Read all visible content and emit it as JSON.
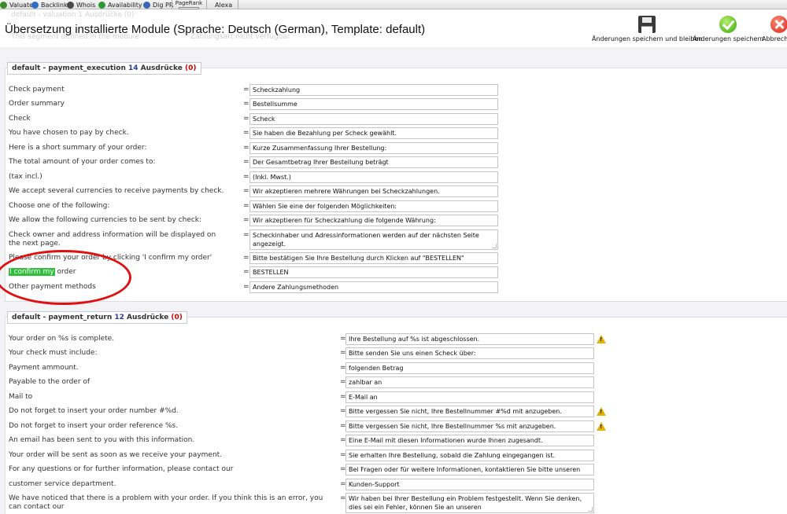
{
  "toolbar": {
    "items": [
      {
        "label": "Valuate",
        "color": "#3a8c2a"
      },
      {
        "label": "Backlinks",
        "color": "#2b6cc4"
      },
      {
        "label": "Whois",
        "color": "#4a4a4a"
      },
      {
        "label": "Availability",
        "color": "#2f9a35"
      },
      {
        "label": "Dig PR",
        "color": "#3a66b8"
      }
    ],
    "pagerank_label": "PageRank",
    "alexa_label": "Alexa"
  },
  "header": {
    "ghost_top": "default - valuation 1 Ausdrücke (0)",
    "ghost_left": "This segment defined in the module",
    "ghost_mid": "Zahlungsart nicht verfügbar",
    "title": "Übersetzung installierte Module (Sprache: Deutsch (German), Template: default)",
    "actions": [
      {
        "label": "Änderungen speichern und bleiben",
        "icon": "floppy-disk-icon"
      },
      {
        "label": "Änderungen speichern",
        "icon": "checkmark-icon"
      },
      {
        "label": "Abbrechen",
        "icon": "cancel-icon"
      }
    ]
  },
  "sections": [
    {
      "prefix": "default - payment_execution ",
      "count": "14",
      "word": " Ausdrücke ",
      "errors": "(0)",
      "rows": [
        {
          "label": "Check payment",
          "value": "Scheckzahlung"
        },
        {
          "label": "Order summary",
          "value": "Bestellsumme"
        },
        {
          "label": "Check",
          "value": "Scheck"
        },
        {
          "label": "You have chosen to pay by check.",
          "value": "Sie haben die Bezahlung per Scheck gewählt."
        },
        {
          "label": "Here is a short summary of your order:",
          "value": "Kurze Zusammenfassung Ihrer Bestellung:"
        },
        {
          "label": "The total amount of your order comes to:",
          "value": "Der Gesamtbetrag Ihrer Bestellung beträgt"
        },
        {
          "label": "(tax incl.)",
          "value": "(Inkl. Mwst.)"
        },
        {
          "label": "We accept several currencies to receive payments by check.",
          "value": "Wir akzeptieren mehrere Währungen bei Scheckzahlungen."
        },
        {
          "label": "Choose one of the following:",
          "value": "Wählen Sie eine der folgenden Möglichkeiten:"
        },
        {
          "label": "We allow the following currencies to be sent by check:",
          "value": "Wir akzeptieren für Scheckzahlung die folgende Währung:"
        },
        {
          "label": "Check owner and address information will be displayed on the next page.",
          "value": "Scheckinhaber und Adressinformationen werden auf der nächsten Seite angezeigt."
        },
        {
          "label": "Please confirm your order by clicking 'I confirm my order'",
          "value": "Bitte bestätigen Sie Ihre Bestellung durch Klicken auf \"BESTELLEN\""
        },
        {
          "label_highlight": "I confirm my",
          "label_rest": " order",
          "value": "BESTELLEN"
        },
        {
          "label": "Other payment methods",
          "value": "Andere Zahlungsmethoden"
        }
      ]
    },
    {
      "prefix": "default - payment_return ",
      "count": "12",
      "word": " Ausdrücke ",
      "errors": "(0)",
      "rows": [
        {
          "label": "Your order on %s is complete.",
          "value": "Ihre Bestellung auf %s ist abgeschlossen.",
          "warning": true
        },
        {
          "label": "Your check must include:",
          "value": "Bitte senden Sie uns einen Scheck über:"
        },
        {
          "label": "Payment ammount.",
          "value": "folgenden Betrag"
        },
        {
          "label": "Payable to the order of",
          "value": "zahlbar an"
        },
        {
          "label": "Mail to",
          "value": "E-Mail an"
        },
        {
          "label": "Do not forget to insert your order number #%d.",
          "value": "Bitte vergessen Sie nicht, Ihre Bestellnummer #%d mit anzugeben.",
          "warning": true
        },
        {
          "label": "Do not forget to insert your order reference %s.",
          "value": "Bitte vergessen Sie nicht, Ihre Bestellnummer %s mit anzugeben.",
          "warning": true
        },
        {
          "label": "An email has been sent to you with this information.",
          "value": "Eine E-Mail mit diesen Informationen wurde Ihnen zugesandt."
        },
        {
          "label": "Your order will be sent as soon as we receive your payment.",
          "value": "Sie erhalten Ihre Bestellung, sobald die Zahlung eingegangen ist."
        },
        {
          "label": "For any questions or for further information, please contact our",
          "value": "Bei Fragen oder für weitere Informationen, kontaktieren Sie bitte unseren"
        },
        {
          "label": "customer service department.",
          "value": "Kunden-Support"
        },
        {
          "label": "We have noticed that there is a problem with your order. If you think this is an error, you can contact our",
          "value": "Wir haben bei Ihrer Bestellung ein Problem festgestellt. Wenn Sie denken, dies sei ein Fehler, können Sie an unseren"
        }
      ]
    }
  ]
}
